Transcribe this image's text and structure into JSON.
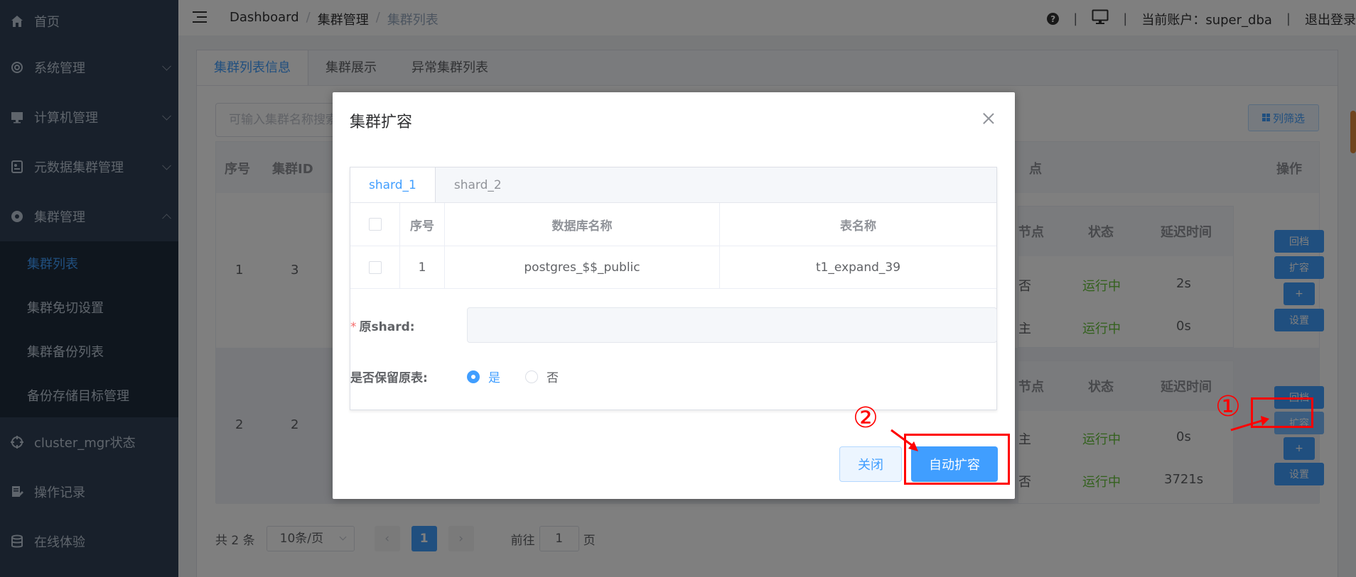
{
  "sidebar": {
    "items": [
      {
        "label": "首页",
        "icon": "home-icon"
      },
      {
        "label": "系统管理",
        "icon": "gear-icon"
      },
      {
        "label": "计算机管理",
        "icon": "monitor-icon"
      },
      {
        "label": "元数据集群管理",
        "icon": "database-card-icon"
      },
      {
        "label": "集群管理",
        "icon": "cluster-icon"
      }
    ],
    "sub_items": [
      {
        "label": "集群列表"
      },
      {
        "label": "集群免切设置"
      },
      {
        "label": "集群备份列表"
      },
      {
        "label": "备份存储目标管理"
      }
    ],
    "bottom_items": [
      {
        "label": "cluster_mgr状态",
        "icon": "target-icon"
      },
      {
        "label": "操作记录",
        "icon": "edit-doc-icon"
      },
      {
        "label": "在线体验",
        "icon": "db-stack-icon"
      }
    ]
  },
  "header": {
    "breadcrumb": [
      "Dashboard",
      "集群管理",
      "集群列表"
    ],
    "separator": "/",
    "account_label": "当前账户：super_dba",
    "logout": "退出登录",
    "help": "?",
    "sep": "|"
  },
  "page": {
    "tabs": [
      "集群列表信息",
      "集群展示",
      "异常集群列表"
    ],
    "search_placeholder": "可输入集群名称搜索",
    "column_filter": "列筛选",
    "table_headers": {
      "index": "序号",
      "cluster_id": "集群ID",
      "op": "操作"
    },
    "nested_headers": {
      "node": "节点",
      "status": "状态",
      "delay": "延迟时间"
    },
    "rows": [
      {
        "index": "1",
        "cluster_id": "3",
        "nodes": [
          {
            "node": "否",
            "status": "运行中",
            "delay": "2s"
          },
          {
            "node": "主",
            "status": "运行中",
            "delay": "0s"
          }
        ]
      },
      {
        "index": "2",
        "cluster_id": "2",
        "nodes": [
          {
            "node": "主",
            "status": "运行中",
            "delay": "0s"
          },
          {
            "node": "否",
            "status": "运行中",
            "delay": "3721s"
          }
        ]
      }
    ],
    "op_buttons": [
      "回档",
      "扩容",
      "+",
      "设置"
    ],
    "pagination": {
      "total": "共 2 条",
      "page_size": "10条/页",
      "current": "1",
      "goto_label": "前往",
      "goto_value": "1",
      "page_word": "页",
      "prev": "‹",
      "next": "›"
    }
  },
  "dialog": {
    "title": "集群扩容",
    "tabs": [
      "shard_1",
      "shard_2"
    ],
    "table_headers": [
      "序号",
      "数据库名称",
      "表名称"
    ],
    "rows": [
      {
        "index": "1",
        "db_name": "postgres_$$_public",
        "table_name": "t1_expand_39"
      }
    ],
    "form": {
      "source_shard_label": "原shard:",
      "required_mark": "*",
      "source_shard_value": "",
      "keep_table_label": "是否保留原表:",
      "options": [
        "是",
        "否"
      ],
      "selected": "是"
    },
    "buttons": {
      "close": "关闭",
      "auto_expand": "自动扩容"
    }
  },
  "annotations": {
    "one": "①",
    "two": "②",
    "color": "#ff0000"
  },
  "colors": {
    "primary": "#409eff",
    "sidebar_bg": "#304156",
    "success": "#67c23a"
  }
}
